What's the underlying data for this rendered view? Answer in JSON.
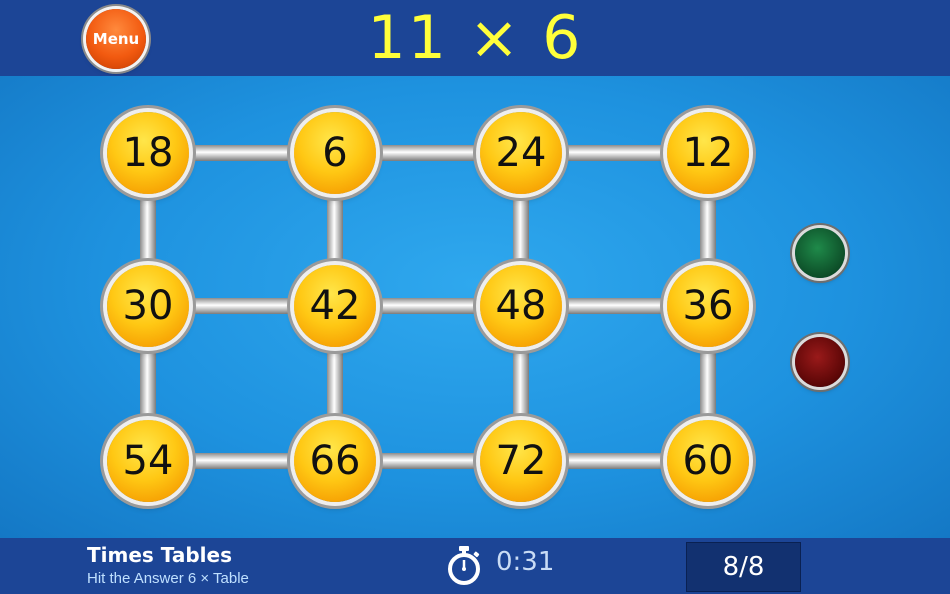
{
  "header": {
    "menu_label": "Menu",
    "question": "11 × 6"
  },
  "grid": {
    "rows": [
      [
        "18",
        "6",
        "24",
        "12"
      ],
      [
        "30",
        "42",
        "48",
        "36"
      ],
      [
        "54",
        "66",
        "72",
        "60"
      ]
    ]
  },
  "indicators": {
    "correct_color": "#0d4e28",
    "wrong_color": "#5a0606"
  },
  "footer": {
    "title": "Times Tables",
    "subtitle": "Hit the Answer 6 × Table",
    "timer": "0:31",
    "score": "8/8"
  },
  "colors": {
    "bar": "#1c4596",
    "board": "#1e92df",
    "question_text": "#ffff3a",
    "ball": "#ffc814"
  }
}
